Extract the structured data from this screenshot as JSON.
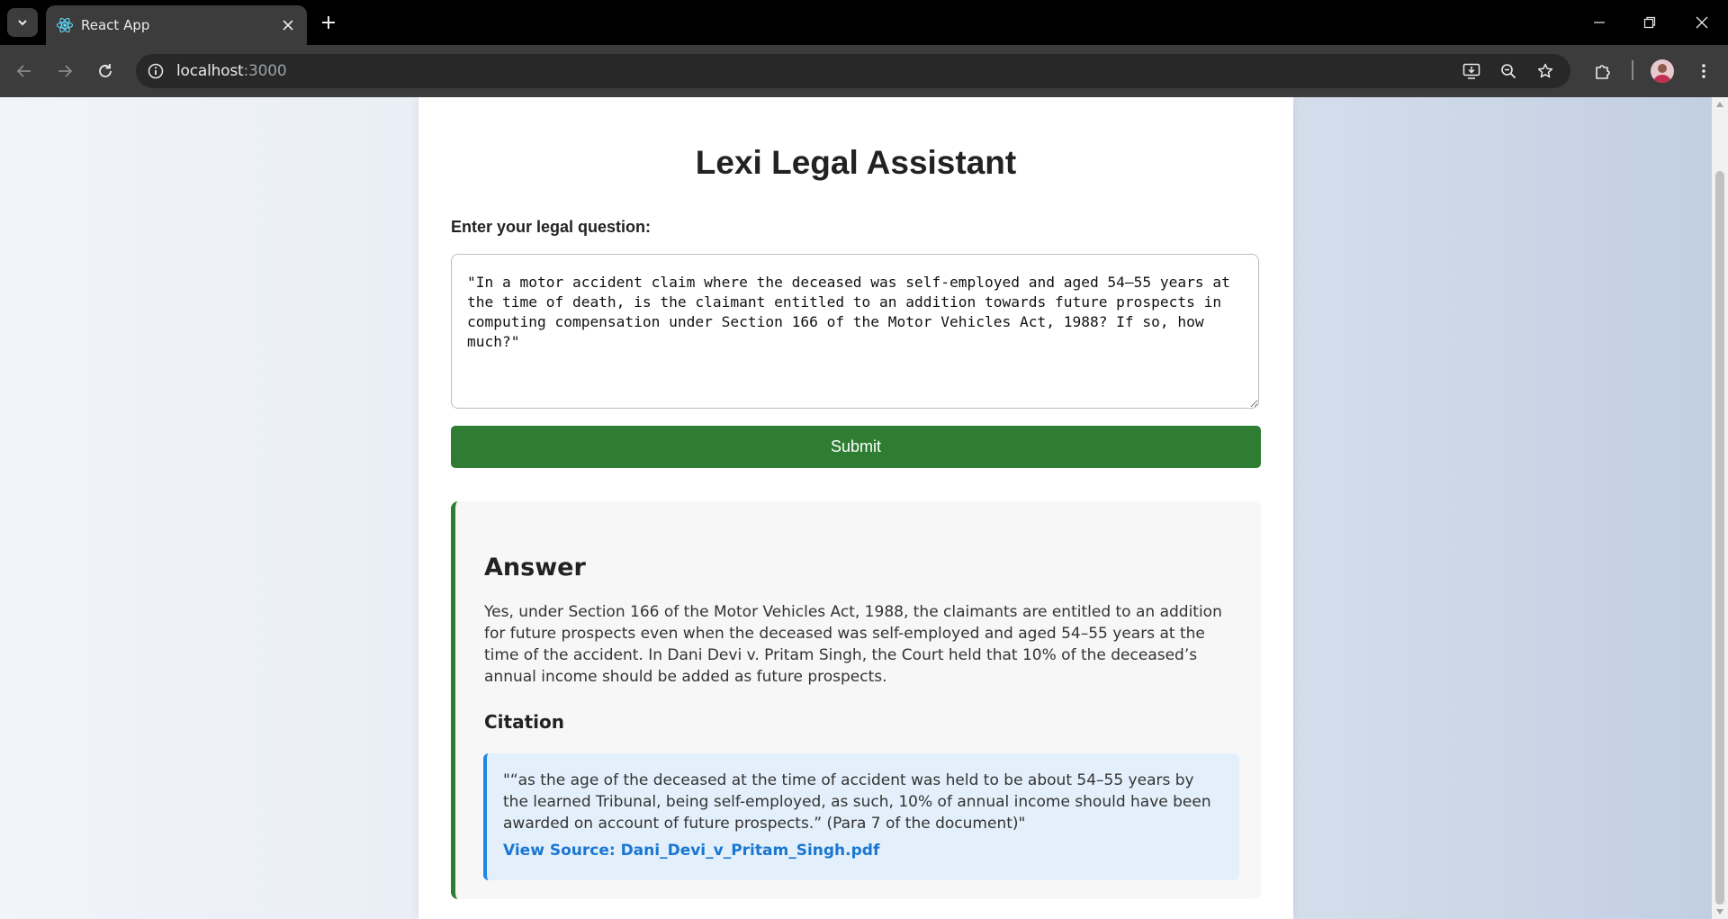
{
  "browser": {
    "tab_title": "React App",
    "url_host": "localhost",
    "url_port": ":3000"
  },
  "app": {
    "title": "Lexi Legal Assistant",
    "question_label": "Enter your legal question:",
    "question_value": "\"In a motor accident claim where the deceased was self-employed and aged 54–55 years at the time of death, is the claimant entitled to an addition towards future prospects in computing compensation under Section 166 of the Motor Vehicles Act, 1988? If so, how much?\"",
    "submit_label": "Submit",
    "answer_heading": "Answer",
    "answer_text": "Yes, under Section 166 of the Motor Vehicles Act, 1988, the claimants are entitled to an addition for future prospects even when the deceased was self-employed and aged 54–55 years at the time of the accident. In Dani Devi v. Pritam Singh, the Court held that 10% of the deceased’s annual income should be added as future prospects.",
    "citation_heading": "Citation",
    "citation_quote": "\"“as the age of the deceased at the time of accident was held to be about 54–55 years by the learned Tribunal, being self-employed, as such, 10% of annual income should have been awarded on account of future prospects.” (Para 7 of the document)\"",
    "source_link": "View Source: Dani_Devi_v_Pritam_Singh.pdf"
  },
  "colors": {
    "submit": "#2e7d32",
    "answer_border": "#2e7d32",
    "citation_border": "#1e88e5",
    "link": "#1976d2"
  }
}
